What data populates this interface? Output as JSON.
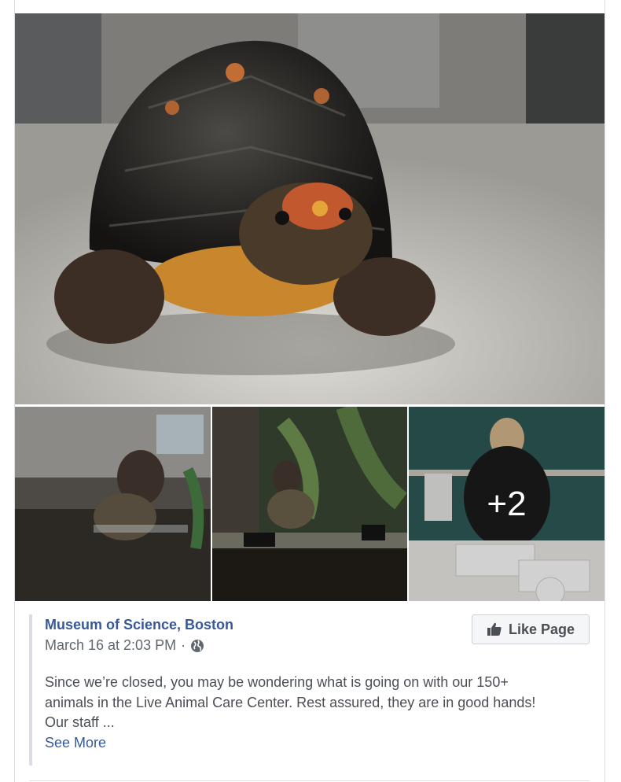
{
  "post": {
    "page_name": "Museum of Science, Boston",
    "timestamp": "March 16 at 2:03 PM",
    "separator": "·",
    "like_button_label": "Like Page",
    "body_lines": [
      "Since we’re closed, you may be wondering what is going on with our 150+",
      "animals in the Live Animal Care Center. Rest assured, they are in good hands!",
      "Our staff ..."
    ],
    "see_more_label": "See More"
  },
  "photos": {
    "more_count_label": "+2"
  },
  "icons": {
    "audience": "globe-icon",
    "like": "thumbs-up-icon"
  },
  "colors": {
    "link": "#385898",
    "text": "#4b4f56",
    "meta": "#606770"
  }
}
